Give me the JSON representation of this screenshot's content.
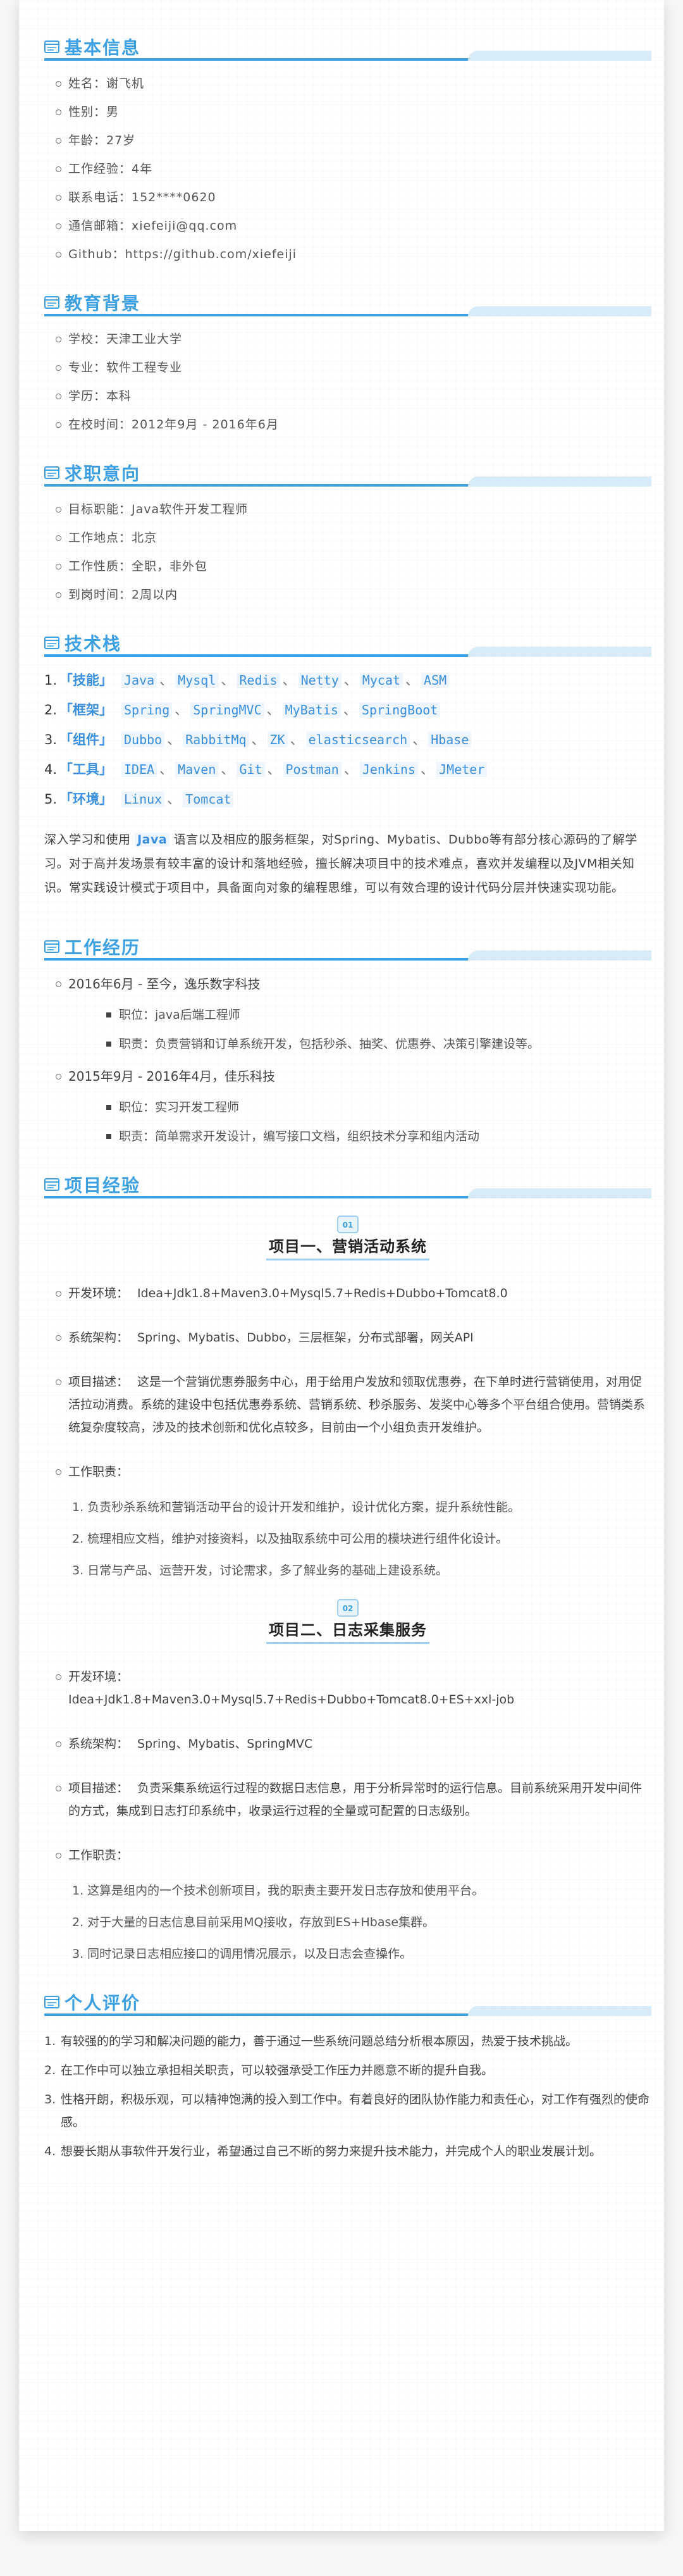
{
  "colors": {
    "accent": "#3ca0e3",
    "keyword_bg": "#eef5fc",
    "keyword_fg": "#3b8fe0"
  },
  "sections": {
    "basic": {
      "icon": "card-icon",
      "title": "基本信息",
      "items": [
        "姓名：谢飞机",
        "性别：男",
        "年龄：27岁",
        "工作经验：4年",
        "联系电话：152****0620",
        "通信邮箱：xiefeiji@qq.com",
        "Github：https://github.com/xiefeiji"
      ]
    },
    "education": {
      "icon": "card-icon",
      "title": "教育背景",
      "items": [
        "学校：天津工业大学",
        "专业：软件工程专业",
        "学历：本科",
        "在校时间：2012年9月 - 2016年6月"
      ]
    },
    "intention": {
      "icon": "card-icon",
      "title": "求职意向",
      "items": [
        "目标职能：Java软件开发工程师",
        "工作地点：北京",
        "工作性质：全职，非外包",
        "到岗时间：2周以内"
      ]
    },
    "stack": {
      "icon": "card-icon",
      "title": "技术栈",
      "rows": [
        {
          "num": "1.",
          "cat": "「技能」",
          "sep": "、",
          "items": [
            "Java",
            "Mysql",
            "Redis",
            "Netty",
            "Mycat",
            "ASM"
          ]
        },
        {
          "num": "2.",
          "cat": "「框架」",
          "sep": "、",
          "items": [
            "Spring",
            "SpringMVC",
            "MyBatis",
            "SpringBoot"
          ]
        },
        {
          "num": "3.",
          "cat": "「组件」",
          "sep": "、",
          "items": [
            "Dubbo",
            "RabbitMq",
            "ZK",
            "elasticsearch",
            "Hbase"
          ]
        },
        {
          "num": "4.",
          "cat": "「工具」",
          "sep": "、",
          "items": [
            "IDEA",
            "Maven",
            "Git",
            "Postman",
            "Jenkins",
            "JMeter"
          ]
        },
        {
          "num": "5.",
          "cat": "「环境」",
          "sep": "、",
          "items": [
            "Linux",
            "Tomcat"
          ]
        }
      ],
      "summary_prefix": "深入学习和使用",
      "summary_keyword": "Java",
      "summary_rest": "语言以及相应的服务框架，对Spring、Mybatis、Dubbo等有部分核心源码的了解学习。对于高并发场景有较丰富的设计和落地经验，擅长解决项目中的技术难点，喜欢并发编程以及JVM相关知识。常实践设计模式于项目中，具备面向对象的编程思维，可以有效合理的设计代码分层并快速实现功能。"
    },
    "work": {
      "icon": "card-icon",
      "title": "工作经历",
      "jobs": [
        {
          "header": "2016年6月 - 至今，逸乐数字科技",
          "details": [
            "职位：java后端工程师",
            "职责：负责营销和订单系统开发，包括秒杀、抽奖、优惠券、决策引擎建设等。"
          ]
        },
        {
          "header": "2015年9月 - 2016年4月，佳乐科技",
          "details": [
            "职位：实习开发工程师",
            "职责：简单需求开发设计，编写接口文档，组织技术分享和组内活动"
          ]
        }
      ]
    },
    "projects": {
      "icon": "card-icon",
      "title": "项目经验",
      "list": [
        {
          "icon": "project-badge-icon",
          "title": "项目一、营销活动系统",
          "env_label": "开发环境：",
          "env": "Idea+Jdk1.8+Maven3.0+Mysql5.7+Redis+Dubbo+Tomcat8.0",
          "arch_label": "系统架构：",
          "arch": "Spring、Mybatis、Dubbo，三层框架，分布式部署，网关API",
          "desc_label": "项目描述：",
          "desc": "这是一个营销优惠券服务中心，用于给用户发放和领取优惠券，在下单时进行营销使用，对用促活拉动消费。系统的建设中包括优惠券系统、营销系统、秒杀服务、发奖中心等多个平台组合使用。营销类系统复杂度较高，涉及的技术创新和优化点较多，目前由一个小组负责开发维护。",
          "duty_label": "工作职责：",
          "duties": [
            "1. 负责秒杀系统和营销活动平台的设计开发和维护，设计优化方案，提升系统性能。",
            "2. 梳理相应文档，维护对接资料，以及抽取系统中可公用的模块进行组件化设计。",
            "3. 日常与产品、运营开发，讨论需求，多了解业务的基础上建设系统。"
          ]
        },
        {
          "icon": "project-badge-icon",
          "title": "项目二、日志采集服务",
          "env_label": "开发环境：",
          "env": "Idea+Jdk1.8+Maven3.0+Mysql5.7+Redis+Dubbo+Tomcat8.0+ES+xxl-job",
          "arch_label": "系统架构：",
          "arch": "Spring、Mybatis、SpringMVC",
          "desc_label": "项目描述：",
          "desc": "负责采集系统运行过程的数据日志信息，用于分析异常时的运行信息。目前系统采用开发中间件的方式，集成到日志打印系统中，收录运行过程的全量或可配置的日志级别。",
          "duty_label": "工作职责：",
          "duties": [
            "1. 这算是组内的一个技术创新项目，我的职责主要开发日志存放和使用平台。",
            "2. 对于大量的日志信息目前采用MQ接收，存放到ES+Hbase集群。",
            "3. 同时记录日志相应接口的调用情况展示，以及日志会查操作。"
          ]
        }
      ]
    },
    "evaluation": {
      "icon": "card-icon",
      "title": "个人评价",
      "items": [
        {
          "n": "1.",
          "text": "有较强的的学习和解决问题的能力，善于通过一些系统问题总结分析根本原因，热爱于技术挑战。"
        },
        {
          "n": "2.",
          "text": "在工作中可以独立承担相关职责，可以较强承受工作压力并愿意不断的提升自我。"
        },
        {
          "n": "3.",
          "text": "性格开朗，积极乐观，可以精神饱满的投入到工作中。有着良好的团队协作能力和责任心，对工作有强烈的使命感。"
        },
        {
          "n": "4.",
          "text": "想要长期从事软件开发行业，希望通过自己不断的努力来提升技术能力，并完成个人的职业发展计划。"
        }
      ]
    }
  }
}
